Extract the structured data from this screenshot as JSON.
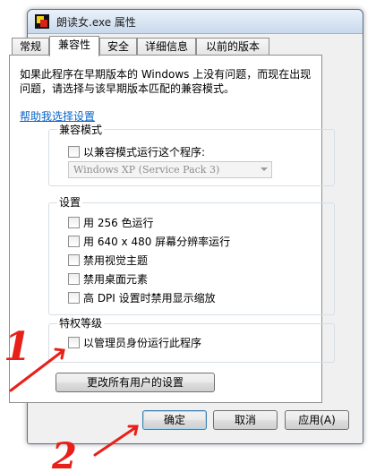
{
  "window": {
    "title": "朗读女.exe 属性"
  },
  "tabs": [
    {
      "label": "常规"
    },
    {
      "label": "兼容性"
    },
    {
      "label": "安全"
    },
    {
      "label": "详细信息"
    },
    {
      "label": "以前的版本"
    }
  ],
  "description": "如果此程序在早期版本的 Windows 上没有问题，而现在出现问题，请选择与该早期版本匹配的兼容模式。",
  "help_link": "帮助我选择设置",
  "compat_mode": {
    "title": "兼容模式",
    "checkbox_label": "以兼容模式运行这个程序:",
    "combo_value": "Windows XP (Service Pack 3)"
  },
  "settings": {
    "title": "设置",
    "options": [
      {
        "label": "用 256 色运行"
      },
      {
        "label": "用 640 x 480 屏幕分辨率运行"
      },
      {
        "label": "禁用视觉主题"
      },
      {
        "label": "禁用桌面元素"
      },
      {
        "label": "高 DPI 设置时禁用显示缩放"
      }
    ]
  },
  "privilege": {
    "title": "特权等级",
    "checkbox_label": "以管理员身份运行此程序"
  },
  "buttons": {
    "change_all": "更改所有用户的设置",
    "ok": "确定",
    "cancel": "取消",
    "apply": "应用(A)"
  },
  "annotations": {
    "color": "#e8201a",
    "step1": "1",
    "step2": "2"
  }
}
